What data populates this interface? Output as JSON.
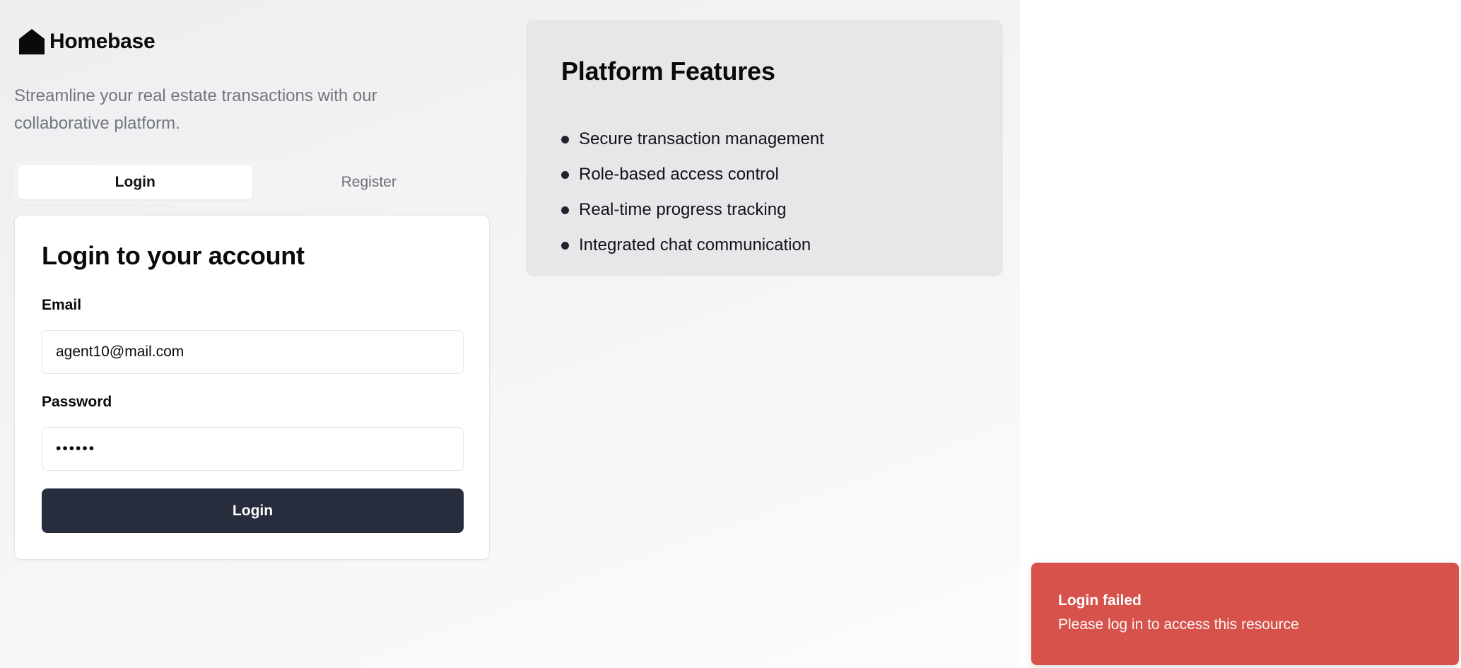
{
  "brand": {
    "logo_icon": "house-icon",
    "name": "Homebase",
    "tagline": "Streamline your real estate transactions with our collaborative platform."
  },
  "tabs": [
    {
      "label": "Login",
      "active": true
    },
    {
      "label": "Register",
      "active": false
    }
  ],
  "login_form": {
    "title": "Login to your account",
    "email_label": "Email",
    "email_value": "agent10@mail.com",
    "password_label": "Password",
    "password_value": "••••••",
    "submit_label": "Login"
  },
  "features": {
    "title": "Platform Features",
    "items": [
      "Secure transaction management",
      "Role-based access control",
      "Real-time progress tracking",
      "Integrated chat communication"
    ]
  },
  "toast": {
    "title": "Login failed",
    "message": "Please log in to access this resource"
  },
  "colors": {
    "primary_button": "#282d3d",
    "toast_error": "#d7524b",
    "features_panel": "#e7e7e9"
  }
}
